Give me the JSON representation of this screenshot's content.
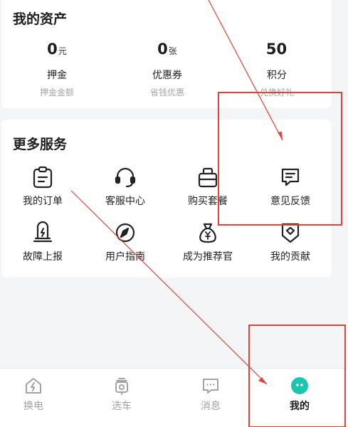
{
  "assets": {
    "title": "我的资产",
    "items": [
      {
        "value": "0",
        "unit": "元",
        "label": "押金",
        "sub": "押金金额"
      },
      {
        "value": "0",
        "unit": "张",
        "label": "优惠券",
        "sub": "省钱优惠"
      },
      {
        "value": "50",
        "unit": "",
        "label": "积分",
        "sub": "兑换好礼"
      }
    ]
  },
  "services": {
    "title": "更多服务",
    "items": [
      {
        "label": "我的订单",
        "icon": "clipboard-icon"
      },
      {
        "label": "客服中心",
        "icon": "headset-icon"
      },
      {
        "label": "购买套餐",
        "icon": "package-icon"
      },
      {
        "label": "意见反馈",
        "icon": "feedback-icon"
      },
      {
        "label": "故障上报",
        "icon": "fault-report-icon"
      },
      {
        "label": "用户指南",
        "icon": "compass-icon"
      },
      {
        "label": "成为推荐官",
        "icon": "money-bag-icon"
      },
      {
        "label": "我的贡献",
        "icon": "badge-icon"
      }
    ]
  },
  "tabs": [
    {
      "label": "换电",
      "icon": "battery-swap-icon",
      "active": false
    },
    {
      "label": "选车",
      "icon": "scooter-icon",
      "active": false
    },
    {
      "label": "消息",
      "icon": "message-icon",
      "active": false
    },
    {
      "label": "我的",
      "icon": "profile-icon",
      "active": true
    }
  ],
  "colors": {
    "accent": "#1cc5b0",
    "annotation": "#e0433a",
    "muted_text": "#a6a6a6"
  }
}
